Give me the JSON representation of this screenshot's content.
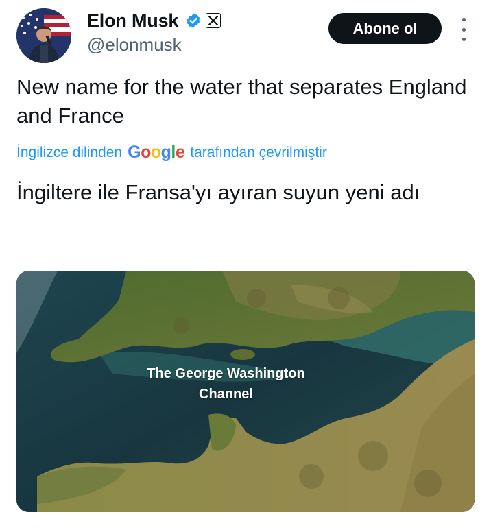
{
  "user": {
    "display_name": "Elon Musk",
    "handle": "@elonmusk",
    "verified_icon": "verified-badge-icon",
    "affiliation_icon": "x-logo-icon"
  },
  "follow_button": {
    "label": "Abone ol"
  },
  "more_icon": "more-vertical-icon",
  "tweet": {
    "text": "New name for the water that separates England and France"
  },
  "translation": {
    "prefix": "İngilizce dilinden",
    "provider": "Google",
    "suffix": "tarafından çevrilmiştir",
    "text": "İngiltere ile Fransa'yı ayıran suyun yeni adı"
  },
  "media": {
    "caption_line1": "The George Washington",
    "caption_line2": "Channel"
  },
  "colors": {
    "link": "#1d9bf0",
    "text": "#0f1419",
    "secondary": "#536471",
    "button": "#0f1419",
    "verified": "#1d9bf0"
  }
}
